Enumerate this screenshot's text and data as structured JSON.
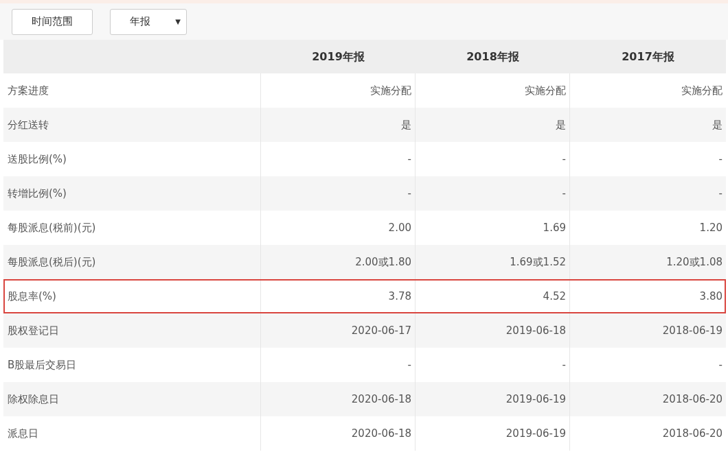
{
  "toolbar": {
    "range_button": "时间范围",
    "period_dropdown": {
      "value": "年报",
      "caret": "▼"
    }
  },
  "table": {
    "columns": [
      "2019年报",
      "2018年报",
      "2017年报"
    ],
    "rows": [
      {
        "label": "方案进度",
        "values": [
          "实施分配",
          "实施分配",
          "实施分配"
        ],
        "highlighted": false
      },
      {
        "label": "分红送转",
        "values": [
          "是",
          "是",
          "是"
        ],
        "highlighted": false
      },
      {
        "label": "送股比例(%)",
        "values": [
          "-",
          "-",
          "-"
        ],
        "highlighted": false
      },
      {
        "label": "转增比例(%)",
        "values": [
          "-",
          "-",
          "-"
        ],
        "highlighted": false
      },
      {
        "label": "每股派息(税前)(元)",
        "values": [
          "2.00",
          "1.69",
          "1.20"
        ],
        "highlighted": false
      },
      {
        "label": "每股派息(税后)(元)",
        "values": [
          "2.00或1.80",
          "1.69或1.52",
          "1.20或1.08"
        ],
        "highlighted": false
      },
      {
        "label": "股息率(%)",
        "values": [
          "3.78",
          "4.52",
          "3.80"
        ],
        "highlighted": true
      },
      {
        "label": "股权登记日",
        "values": [
          "2020-06-17",
          "2019-06-18",
          "2018-06-19"
        ],
        "highlighted": false
      },
      {
        "label": "B股最后交易日",
        "values": [
          "-",
          "-",
          "-"
        ],
        "highlighted": false
      },
      {
        "label": "除权除息日",
        "values": [
          "2020-06-18",
          "2019-06-19",
          "2018-06-20"
        ],
        "highlighted": false
      },
      {
        "label": "派息日",
        "values": [
          "2020-06-18",
          "2019-06-19",
          "2018-06-20"
        ],
        "highlighted": false
      }
    ]
  }
}
